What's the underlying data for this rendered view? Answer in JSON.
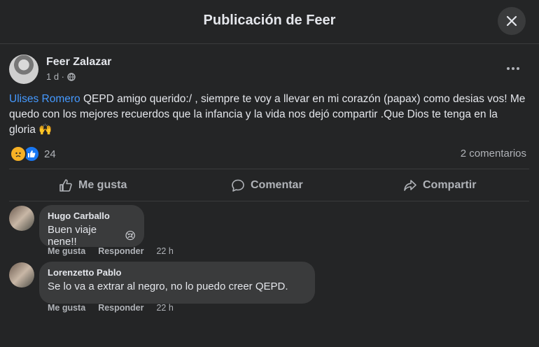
{
  "header": {
    "title": "Publicación de Feer"
  },
  "post": {
    "author": "Feer Zalazar",
    "time": "1 d ·",
    "mention": "Ulises Romero",
    "text": " QEPD amigo querido:/ , siempre te voy a llevar en mi corazón (papax) como desias vos! Me quedo con los mejores recuerdos que la infancia y la vida nos dejó compartir .Que Dios te tenga en la gloria ",
    "emoji": "🙌",
    "reaction_count": "24",
    "comment_count": "2 comentarios"
  },
  "actions": {
    "like": "Me gusta",
    "comment": "Comentar",
    "share": "Compartir"
  },
  "comments": [
    {
      "name": "Hugo Carballo",
      "text": "Buen viaje nene!!",
      "emoji": "😢",
      "like": "Me gusta",
      "reply": "Responder",
      "time": "22 h"
    },
    {
      "name": "Lorenzetto Pablo",
      "text": "Se lo va a extrar al negro, no lo puedo creer QEPD.",
      "like": "Me gusta",
      "reply": "Responder",
      "time": "22 h"
    }
  ],
  "colors": {
    "background": "#242526",
    "bubble": "#3a3b3c",
    "mention": "#4599ff",
    "like": "#1877f2",
    "sad": "#f7b125"
  }
}
